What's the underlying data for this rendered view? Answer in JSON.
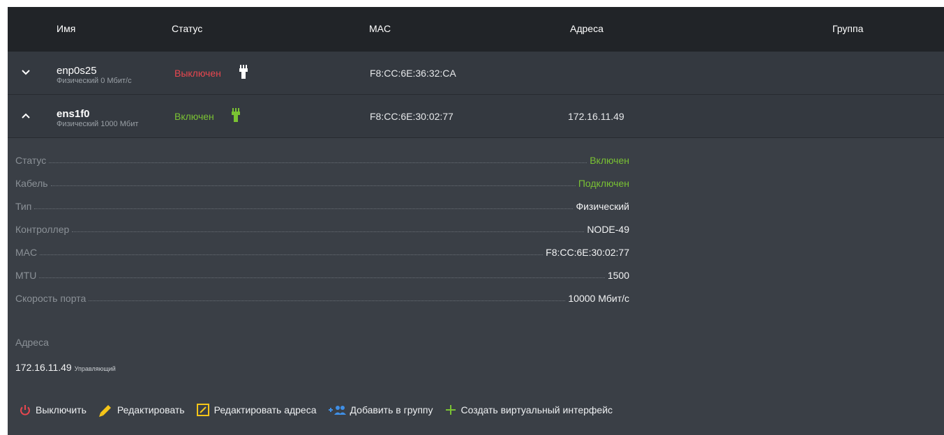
{
  "header": {
    "name": "Имя",
    "status": "Статус",
    "mac": "MAC",
    "addresses": "Адреса",
    "group": "Группа"
  },
  "rows": [
    {
      "name": "enp0s25",
      "sub": "Физический 0 Мбит/с",
      "status": "Выключен",
      "mac": "F8:CC:6E:36:32:CA",
      "address": "",
      "expanded": false
    },
    {
      "name": "ens1f0",
      "sub": "Физический 1000 Мбит",
      "status": "Включен",
      "mac": "F8:CC:6E:30:02:77",
      "address": "172.16.11.49",
      "expanded": true
    }
  ],
  "details": [
    {
      "label": "Статус",
      "value": "Включен",
      "color": "#7ac233"
    },
    {
      "label": "Кабель",
      "value": "Подключен",
      "color": "#7ac233"
    },
    {
      "label": "Тип",
      "value": "Физический"
    },
    {
      "label": "Контроллер",
      "value": "NODE-49"
    },
    {
      "label": "MAC",
      "value": "F8:CC:6E:30:02:77"
    },
    {
      "label": "MTU",
      "value": "1500"
    },
    {
      "label": "Скорость порта",
      "value": "10000 Мбит/с"
    }
  ],
  "addresses_section": {
    "title": "Адреса",
    "address": "172.16.11.49",
    "tag": "Управляющий"
  },
  "actions": {
    "power_off": "Выключить",
    "edit": "Редактировать",
    "edit_addresses": "Редактировать адреса",
    "add_to_group": "Добавить в группу",
    "create_virtual": "Создать виртуальный интерфейс"
  },
  "icons": {
    "row0_chevron": "chevron-down-icon",
    "row1_chevron": "chevron-up-icon",
    "plug": "ethernet-plug-icon",
    "power": "power-icon",
    "pencil": "pencil-icon",
    "edit_box": "edit-box-icon",
    "add_users": "add-users-icon",
    "plus": "plus-icon"
  },
  "colors": {
    "off": "#e8474f",
    "on": "#7ac233",
    "plug_off": "#ffffff",
    "plug_on": "#7ac233",
    "power_icon": "#e8474f",
    "pencil_icon": "#f5c518",
    "add_users_icon": "#3f8fe6",
    "plus_icon": "#7ac233"
  }
}
